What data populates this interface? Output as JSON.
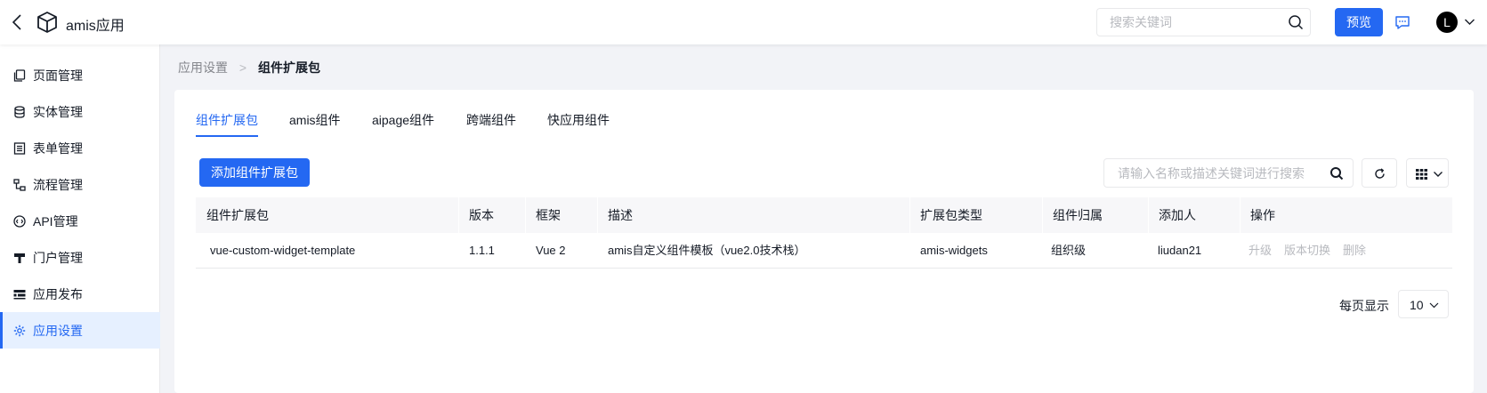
{
  "header": {
    "app_name": "amis应用",
    "search_placeholder": "搜索关键词",
    "preview_label": "预览",
    "avatar_letter": "L"
  },
  "sidebar": {
    "items": [
      {
        "label": "页面管理",
        "icon": "page-manage-icon"
      },
      {
        "label": "实体管理",
        "icon": "database-icon"
      },
      {
        "label": "表单管理",
        "icon": "form-icon"
      },
      {
        "label": "流程管理",
        "icon": "flow-icon"
      },
      {
        "label": "API管理",
        "icon": "api-icon"
      },
      {
        "label": "门户管理",
        "icon": "portal-icon"
      },
      {
        "label": "应用发布",
        "icon": "publish-icon"
      },
      {
        "label": "应用设置",
        "icon": "gear-icon",
        "active": true
      }
    ]
  },
  "breadcrumb": {
    "parent": "应用设置",
    "separator": ">",
    "current": "组件扩展包"
  },
  "tabs": [
    "组件扩展包",
    "amis组件",
    "aipage组件",
    "跨端组件",
    "快应用组件"
  ],
  "toolbar": {
    "add_label": "添加组件扩展包",
    "filter_placeholder": "请输入名称或描述关键词进行搜索"
  },
  "table": {
    "columns": [
      "组件扩展包",
      "版本",
      "框架",
      "描述",
      "扩展包类型",
      "组件归属",
      "添加人",
      "操作"
    ],
    "rows": [
      {
        "name": "vue-custom-widget-template",
        "version": "1.1.1",
        "framework": "Vue 2",
        "description": "amis自定义组件模板（vue2.0技术栈）",
        "type": "amis-widgets",
        "owner": "组织级",
        "added_by": "liudan21",
        "actions": [
          "升级",
          "版本切换",
          "删除"
        ]
      }
    ]
  },
  "pagination": {
    "per_page_label": "每页显示",
    "per_page_value": "10"
  },
  "colors": {
    "primary": "#2468f2",
    "text": "#151b26",
    "muted": "#84868c",
    "disabled": "#b8babf",
    "active_bg": "#e6f0ff"
  }
}
